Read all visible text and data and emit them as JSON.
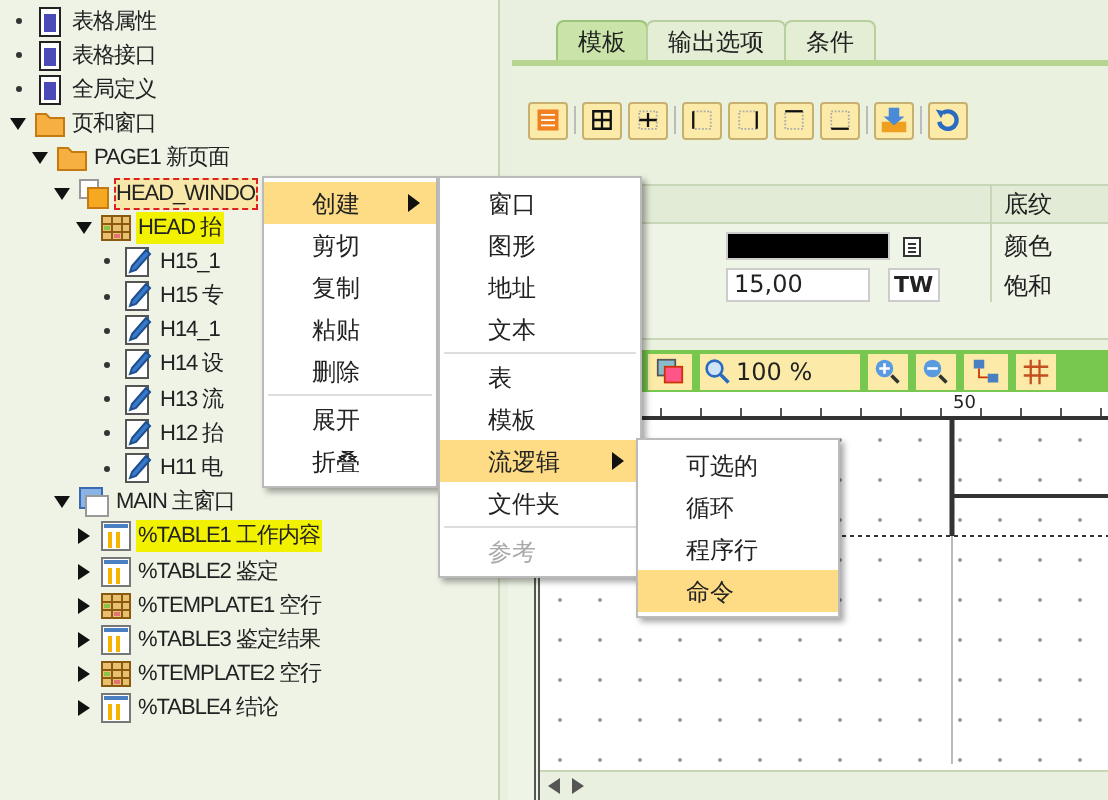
{
  "tree": [
    {
      "label": "表格属性",
      "kind": "doc",
      "selected": false
    },
    {
      "label": "表格接口",
      "kind": "doc",
      "selected": false
    },
    {
      "label": "全局定义",
      "kind": "doc",
      "selected": false
    },
    {
      "label": "页和窗口",
      "kind": "folder",
      "selected": false,
      "expanded": true,
      "children": [
        {
          "label": "PAGE1 新页面",
          "kind": "folder",
          "selected": false,
          "expanded": true,
          "children": [
            {
              "label": "HEAD_WINDO",
              "kind": "window",
              "selected": false,
              "focused": true,
              "expanded": true,
              "children": [
                {
                  "label": "HEAD 抬",
                  "kind": "template",
                  "selected": true,
                  "expanded": true,
                  "children": [
                    {
                      "label": "H15_1",
                      "kind": "text",
                      "selected": false
                    },
                    {
                      "label": "H15 专",
                      "kind": "text",
                      "selected": false
                    },
                    {
                      "label": "H14_1",
                      "kind": "text",
                      "selected": false
                    },
                    {
                      "label": "H14 设",
                      "kind": "text",
                      "selected": false
                    },
                    {
                      "label": "H13 流",
                      "kind": "text",
                      "selected": false
                    },
                    {
                      "label": "H12 抬",
                      "kind": "text",
                      "selected": false
                    },
                    {
                      "label": "H11 电",
                      "kind": "text",
                      "selected": false
                    }
                  ]
                }
              ]
            },
            {
              "label": "MAIN 主窗口",
              "kind": "main",
              "selected": false,
              "expanded": true,
              "children": [
                {
                  "label": "%TABLE1 工作内容",
                  "kind": "table",
                  "selected": true,
                  "expanded": false
                },
                {
                  "label": "%TABLE2 鉴定",
                  "kind": "table",
                  "selected": false,
                  "expanded": false
                },
                {
                  "label": "%TEMPLATE1 空行",
                  "kind": "template",
                  "selected": false,
                  "expanded": false
                },
                {
                  "label": "%TABLE3 鉴定结果",
                  "kind": "table",
                  "selected": false,
                  "expanded": false
                },
                {
                  "label": "%TEMPLATE2 空行",
                  "kind": "template",
                  "selected": false,
                  "expanded": false
                },
                {
                  "label": "%TABLE4 结论",
                  "kind": "table",
                  "selected": false,
                  "expanded": false
                }
              ]
            }
          ]
        }
      ]
    }
  ],
  "tabs": [
    {
      "label": "模板",
      "selected": true
    },
    {
      "label": "输出选项",
      "selected": false
    },
    {
      "label": "条件",
      "selected": false
    }
  ],
  "properties": {
    "header": "底纹",
    "width_value": "15,00",
    "unit_button": "TW",
    "labels": [
      "颜色",
      "饱和"
    ]
  },
  "zoom": "100 %",
  "ruler_mark": "50",
  "menus": [
    [
      {
        "label": "创建",
        "selected": true,
        "submenu": true
      },
      {
        "label": "剪切",
        "selected": false
      },
      {
        "label": "复制",
        "selected": false
      },
      {
        "label": "粘贴",
        "selected": false
      },
      {
        "label": "删除",
        "selected": false
      },
      {
        "label": "展开",
        "selected": false,
        "divider": true
      },
      {
        "label": "折叠",
        "selected": false
      }
    ],
    [
      {
        "label": "窗口",
        "selected": false
      },
      {
        "label": "图形",
        "selected": false
      },
      {
        "label": "地址",
        "selected": false
      },
      {
        "label": "文本",
        "selected": false
      },
      {
        "label": "表",
        "selected": false,
        "divider": true
      },
      {
        "label": "模板",
        "selected": false
      },
      {
        "label": "流逻辑",
        "selected": true,
        "submenu": true
      },
      {
        "label": "文件夹",
        "selected": false
      },
      {
        "label": "参考",
        "selected": false,
        "disabled": true,
        "divider": true
      }
    ],
    [
      {
        "label": "可选的",
        "selected": false
      },
      {
        "label": "循环",
        "selected": false
      },
      {
        "label": "程序行",
        "selected": false
      },
      {
        "label": "命令",
        "selected": true
      }
    ]
  ]
}
